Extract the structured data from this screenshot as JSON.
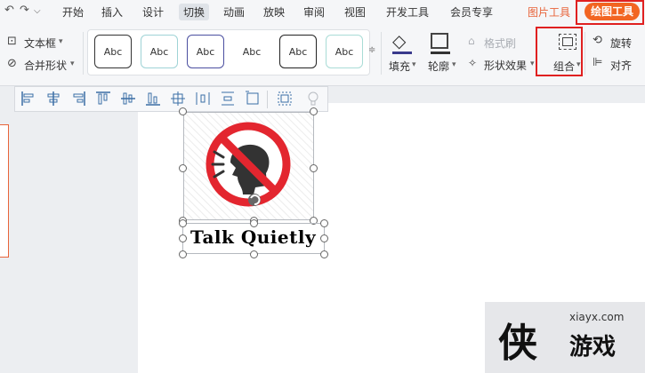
{
  "menubar": {
    "items": [
      "开始",
      "插入",
      "设计",
      "切换",
      "动画",
      "放映",
      "审阅",
      "视图",
      "开发工具",
      "会员专享"
    ],
    "active_index": 3,
    "picture_tools": "图片工具",
    "drawing_tools": "绘图工具"
  },
  "ribbon": {
    "textbox": "文本框",
    "merge_shapes": "合并形状",
    "style_label": "Abc",
    "format_painter": "格式刷",
    "fill": "填充",
    "outline": "轮廓",
    "shape_effects": "形状效果",
    "group": "组合",
    "rotate": "旋转",
    "align": "对齐"
  },
  "canvas": {
    "text": "Talk  Quietly"
  },
  "watermark": {
    "url": "xiayx.com",
    "big": "侠",
    "small": "游戏"
  },
  "colors": {
    "accent": "#f26522",
    "highlight_box": "#e02020",
    "no_sign": "#e3262f"
  }
}
